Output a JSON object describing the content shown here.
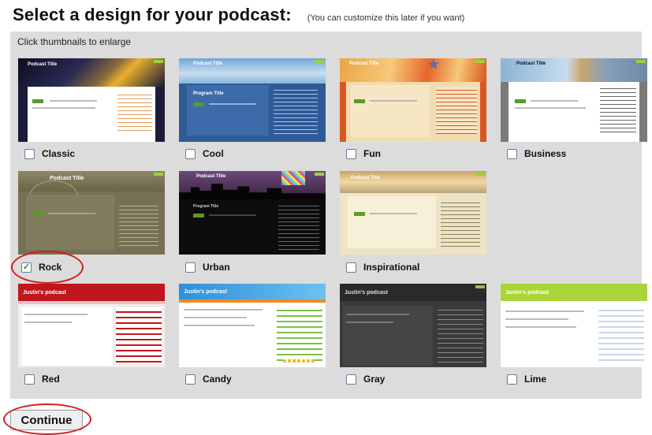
{
  "header": {
    "title": "Select a design for your podcast:",
    "subtitle": "(You can customize this later if you want)"
  },
  "hint": "Click thumbnails to enlarge",
  "thumb_text": {
    "podcast_title": "Podcast Title",
    "justins_podcast": "Justin's podcast"
  },
  "designs": [
    {
      "label": "Classic",
      "checked": false
    },
    {
      "label": "Cool",
      "checked": false
    },
    {
      "label": "Fun",
      "checked": false
    },
    {
      "label": "Business",
      "checked": false
    },
    {
      "label": "Rock",
      "checked": true
    },
    {
      "label": "Urban",
      "checked": false
    },
    {
      "label": "Inspirational",
      "checked": false
    },
    {
      "label": "Red",
      "checked": false
    },
    {
      "label": "Candy",
      "checked": false
    },
    {
      "label": "Gray",
      "checked": false
    },
    {
      "label": "Lime",
      "checked": false
    }
  ],
  "checkmark": "✓",
  "continue_label": "Continue",
  "colors": {
    "highlight_ring": "#d21f1f",
    "panel_bg": "#dcdcdc",
    "checkbox_border": "#6b7c98"
  }
}
